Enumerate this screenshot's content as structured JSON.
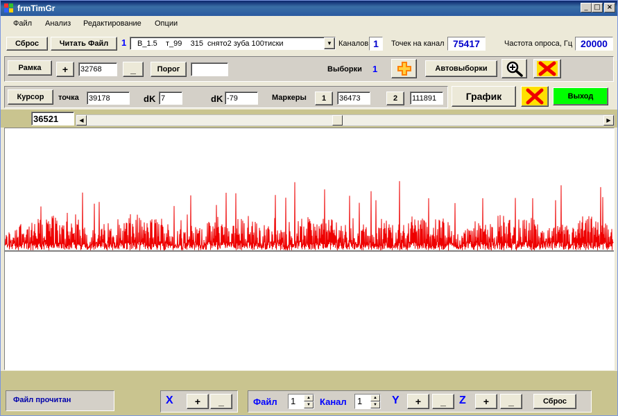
{
  "window": {
    "title": "frmTimGr"
  },
  "menu": {
    "items": [
      "Файл",
      "Анализ",
      "Редактирование",
      "Опции"
    ]
  },
  "row1": {
    "reset_label": "Сброс",
    "read_file_label": "Читать Файл",
    "file_index": "1",
    "file_combo": "В_1.5    т_99    315  снято2 зуба 100тиски",
    "channels_label": "Каналов",
    "channels_value": "1",
    "points_label": "Точек на канал",
    "points_value": "75417",
    "freq_label": "Частота опроса, Гц",
    "freq_value": "20000"
  },
  "row2": {
    "frame_label": "Рамка",
    "plus_label": "+",
    "frame_value": "32768",
    "minus_label": "_",
    "threshold_label": "Порог",
    "threshold_value": "",
    "samples_label": "Выборки",
    "samples_value": "1",
    "auto_samples_label": "Автовыборки"
  },
  "row3": {
    "cursor_label": "Курсор",
    "point_label": "точка",
    "point_value": "39178",
    "dk1_label": "dK",
    "dk1_value": "7",
    "dk2_label": "dK",
    "dk2_value": "-79",
    "markers_label": "Маркеры",
    "marker1_label": "1",
    "marker1_value": "36473",
    "marker2_label": "2",
    "marker2_value": "111891",
    "graph_label": "График",
    "exit_label": "Выход"
  },
  "position": {
    "value": "36521"
  },
  "status": {
    "text": "Файл прочитан"
  },
  "bottom": {
    "x_label": "X",
    "x_plus": "+",
    "x_minus": "_",
    "file_label": "Файл",
    "file_spin": "1",
    "channel_label": "Канал",
    "channel_spin": "1",
    "y_label": "Y",
    "y_plus": "+",
    "y_minus": "_",
    "z_label": "Z",
    "z_plus": "+",
    "z_minus": "_",
    "reset_label": "Сброс"
  },
  "colors": {
    "signal": "#ee0000",
    "accent_blue": "#0000ff",
    "exit_green": "#00ff00",
    "olive": "#c9c48f"
  }
}
